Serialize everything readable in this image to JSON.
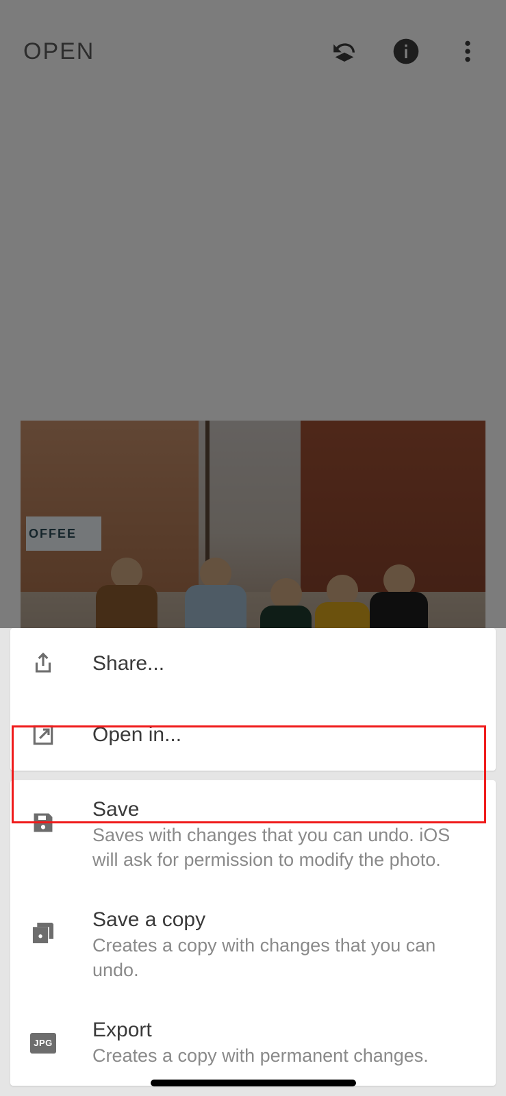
{
  "header": {
    "open_label": "OPEN"
  },
  "photo": {
    "sign_text": "OFFEE"
  },
  "sheet": {
    "group1": [
      {
        "icon": "share-icon",
        "title": "Share...",
        "subtitle": null
      },
      {
        "icon": "open-in-icon",
        "title": "Open in...",
        "subtitle": null
      }
    ],
    "group2": [
      {
        "icon": "save-icon",
        "title": "Save",
        "subtitle": "Saves with changes that you can undo. iOS will ask for permission to modify the photo."
      },
      {
        "icon": "save-copy-icon",
        "title": "Save a copy",
        "subtitle": "Creates a copy with changes that you can undo."
      },
      {
        "icon": "jpg-icon",
        "badge": "JPG",
        "title": "Export",
        "subtitle": "Creates a copy with permanent changes."
      }
    ]
  }
}
